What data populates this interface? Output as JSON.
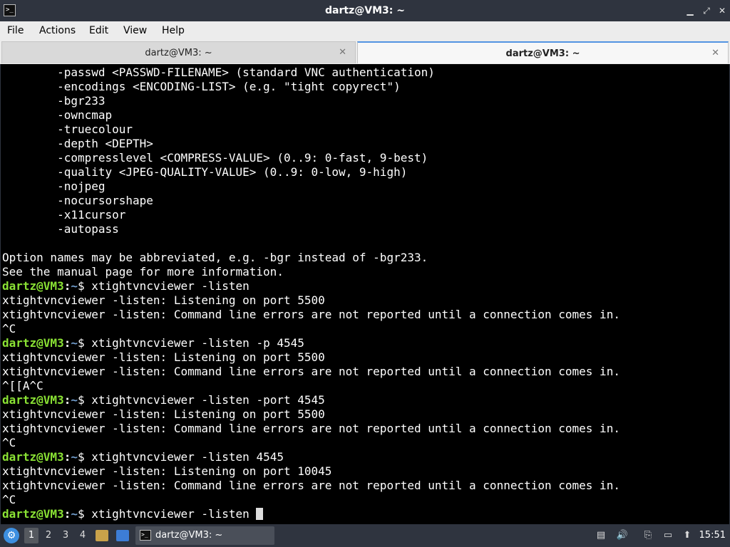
{
  "window": {
    "title": "dartz@VM3: ~",
    "minimize_icon": "minimize-icon",
    "maximize_icon": "maximize-icon",
    "close_icon": "close-icon"
  },
  "menu": {
    "items": [
      "File",
      "Actions",
      "Edit",
      "View",
      "Help"
    ]
  },
  "tabs": [
    {
      "label": "dartz@VM3: ~",
      "active": false
    },
    {
      "label": "dartz@VM3: ~",
      "active": true
    }
  ],
  "prompt": {
    "user": "dartz@VM3",
    "sep": ":",
    "path": "~",
    "symbol": "$ "
  },
  "terminal": {
    "lines": [
      {
        "t": "        -passwd <PASSWD-FILENAME> (standard VNC authentication)"
      },
      {
        "t": "        -encodings <ENCODING-LIST> (e.g. \"tight copyrect\")"
      },
      {
        "t": "        -bgr233"
      },
      {
        "t": "        -owncmap"
      },
      {
        "t": "        -truecolour"
      },
      {
        "t": "        -depth <DEPTH>"
      },
      {
        "t": "        -compresslevel <COMPRESS-VALUE> (0..9: 0-fast, 9-best)"
      },
      {
        "t": "        -quality <JPEG-QUALITY-VALUE> (0..9: 0-low, 9-high)"
      },
      {
        "t": "        -nojpeg"
      },
      {
        "t": "        -nocursorshape"
      },
      {
        "t": "        -x11cursor"
      },
      {
        "t": "        -autopass"
      },
      {
        "t": ""
      },
      {
        "t": "Option names may be abbreviated, e.g. -bgr instead of -bgr233."
      },
      {
        "t": "See the manual page for more information."
      },
      {
        "prompt": true,
        "cmd": "xtightvncviewer -listen"
      },
      {
        "t": "xtightvncviewer -listen: Listening on port 5500"
      },
      {
        "t": "xtightvncviewer -listen: Command line errors are not reported until a connection comes in."
      },
      {
        "t": "^C"
      },
      {
        "prompt": true,
        "cmd": "xtightvncviewer -listen -p 4545"
      },
      {
        "t": "xtightvncviewer -listen: Listening on port 5500"
      },
      {
        "t": "xtightvncviewer -listen: Command line errors are not reported until a connection comes in."
      },
      {
        "t": "^[[A^C"
      },
      {
        "prompt": true,
        "cmd": "xtightvncviewer -listen -port 4545"
      },
      {
        "t": "xtightvncviewer -listen: Listening on port 5500"
      },
      {
        "t": "xtightvncviewer -listen: Command line errors are not reported until a connection comes in."
      },
      {
        "t": "^C"
      },
      {
        "prompt": true,
        "cmd": "xtightvncviewer -listen 4545"
      },
      {
        "t": "xtightvncviewer -listen: Listening on port 10045"
      },
      {
        "t": "xtightvncviewer -listen: Command line errors are not reported until a connection comes in."
      },
      {
        "t": "^C"
      },
      {
        "prompt": true,
        "cmd": "xtightvncviewer -listen ",
        "cursor": true
      }
    ]
  },
  "taskbar": {
    "workspaces": [
      "1",
      "2",
      "3",
      "4"
    ],
    "active_workspace": "1",
    "task_label": "dartz@VM3: ~",
    "clock": "15:51",
    "tray_icons": [
      "network-icon",
      "volume-icon",
      "clipboard-icon",
      "display-icon",
      "update-icon"
    ]
  }
}
